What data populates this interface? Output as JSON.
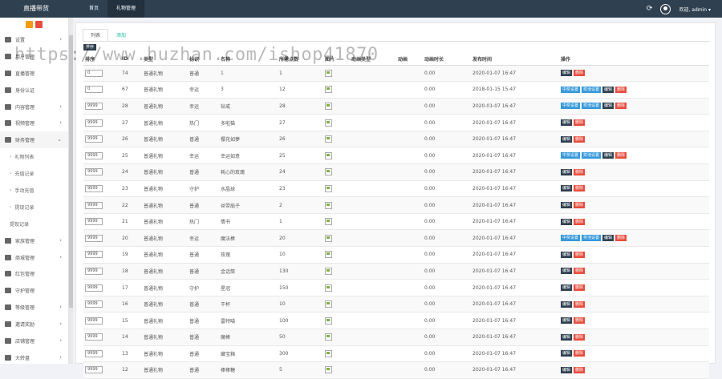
{
  "brand": "直播带货",
  "topnav": [
    {
      "label": "首页",
      "active": false
    },
    {
      "label": "礼物管理",
      "active": true
    }
  ],
  "user": {
    "welcome": "欢迎, admin ▾"
  },
  "sidebar": {
    "items": [
      {
        "label": "设置",
        "icon": "gear-icon",
        "arrow": "›"
      },
      {
        "label": "用户管理",
        "icon": "users-icon",
        "arrow": "›"
      },
      {
        "label": "直播管理",
        "icon": "trophy-icon",
        "arrow": ""
      },
      {
        "label": "身份认证",
        "icon": "id-card-icon",
        "arrow": ""
      },
      {
        "label": "内容管理",
        "icon": "monitor-icon",
        "arrow": "›"
      },
      {
        "label": "视频管理",
        "icon": "video-icon",
        "arrow": "›"
      },
      {
        "label": "财务管理",
        "icon": "yen-icon",
        "arrow": "⌄",
        "open": true
      },
      {
        "label": "礼物列表",
        "sub": true
      },
      {
        "label": "充值记录",
        "sub": true
      },
      {
        "label": "手动充值",
        "sub": true
      },
      {
        "label": "提现记录",
        "sub": true
      },
      {
        "label": "提现记录",
        "sub": true,
        "plain": true
      },
      {
        "label": "家族管理",
        "icon": "family-icon",
        "arrow": "›"
      },
      {
        "label": "商城管理",
        "icon": "cart-icon",
        "arrow": "›"
      },
      {
        "label": "红包管理",
        "icon": "envelope-icon",
        "arrow": ""
      },
      {
        "label": "守护管理",
        "icon": "shield-icon",
        "arrow": ""
      },
      {
        "label": "等级管理",
        "icon": "level-icon",
        "arrow": "›"
      },
      {
        "label": "邀请奖励",
        "icon": "sitemap-icon",
        "arrow": "›"
      },
      {
        "label": "店铺管理",
        "icon": "store-icon",
        "arrow": "›"
      },
      {
        "label": "大转盘",
        "icon": "wheel-icon",
        "arrow": "›"
      }
    ]
  },
  "tabs": {
    "list": "列表",
    "add": "添加"
  },
  "sort_button": "排序",
  "table": {
    "headers": [
      "排序",
      "ID",
      "类型",
      "标识",
      "名称",
      "所需点数",
      "图片",
      "动画类型",
      "动画",
      "动画时长",
      "发布时间",
      "操作"
    ],
    "rows": [
      {
        "sort": "0",
        "id": "74",
        "type": "普通礼物",
        "mark": "普通",
        "name": "1",
        "price": "1",
        "dur": "0.00",
        "time": "2020-01-07 16:47",
        "ops": [
          "编辑",
          "删除"
        ]
      },
      {
        "sort": "0",
        "id": "67",
        "type": "普通礼物",
        "mark": "幸运",
        "name": "3",
        "price": "12",
        "dur": "0.00",
        "time": "2018-01-15 15:47",
        "ops": [
          "中奖设置",
          "奖池设置",
          "编辑",
          "删除"
        ]
      },
      {
        "sort": "9999",
        "id": "28",
        "type": "普通礼物",
        "mark": "幸运",
        "name": "钻戒",
        "price": "28",
        "dur": "0.00",
        "time": "2020-01-07 16:47",
        "ops": [
          "中奖设置",
          "奖池设置",
          "编辑",
          "删除"
        ]
      },
      {
        "sort": "9999",
        "id": "27",
        "type": "普通礼物",
        "mark": "热门",
        "name": "多啦猫",
        "price": "27",
        "dur": "0.00",
        "time": "2020-01-07 16:47",
        "ops": [
          "编辑",
          "删除"
        ]
      },
      {
        "sort": "9999",
        "id": "26",
        "type": "普通礼物",
        "mark": "普通",
        "name": "樱花如夢",
        "price": "26",
        "dur": "0.00",
        "time": "2020-01-07 16:47",
        "ops": [
          "编辑",
          "删除"
        ]
      },
      {
        "sort": "9999",
        "id": "25",
        "type": "普通礼物",
        "mark": "幸运",
        "name": "幸运如意",
        "price": "25",
        "dur": "0.00",
        "time": "2020-01-07 16:47",
        "ops": [
          "中奖设置",
          "奖池设置",
          "编辑",
          "删除"
        ]
      },
      {
        "sort": "9999",
        "id": "24",
        "type": "普通礼物",
        "mark": "普通",
        "name": "耗心的玫瑰",
        "price": "24",
        "dur": "0.00",
        "time": "2020-01-07 16:47",
        "ops": [
          "编辑",
          "删除"
        ]
      },
      {
        "sort": "9999",
        "id": "23",
        "type": "普通礼物",
        "mark": "守护",
        "name": "水晶球",
        "price": "23",
        "dur": "0.00",
        "time": "2020-01-07 16:47",
        "ops": [
          "编辑",
          "删除"
        ]
      },
      {
        "sort": "9999",
        "id": "22",
        "type": "普通礼物",
        "mark": "普通",
        "name": "丝带扇子",
        "price": "2",
        "dur": "0.00",
        "time": "2020-01-07 16:47",
        "ops": [
          "编辑",
          "删除"
        ]
      },
      {
        "sort": "9999",
        "id": "21",
        "type": "普通礼物",
        "mark": "热门",
        "name": "情书",
        "price": "1",
        "dur": "0.00",
        "time": "2020-01-07 16:47",
        "ops": [
          "编辑",
          "删除"
        ]
      },
      {
        "sort": "9999",
        "id": "20",
        "type": "普通礼物",
        "mark": "幸运",
        "name": "魔法棒",
        "price": "20",
        "dur": "0.00",
        "time": "2020-01-07 16:47",
        "ops": [
          "中奖设置",
          "奖池设置",
          "编辑",
          "删除"
        ]
      },
      {
        "sort": "9999",
        "id": "19",
        "type": "普通礼物",
        "mark": "普通",
        "name": "玫瑰",
        "price": "10",
        "dur": "0.00",
        "time": "2020-01-07 16:47",
        "ops": [
          "编辑",
          "删除"
        ]
      },
      {
        "sort": "9999",
        "id": "18",
        "type": "普通礼物",
        "mark": "普通",
        "name": "金话筒",
        "price": "130",
        "dur": "0.00",
        "time": "2020-01-07 16:47",
        "ops": [
          "编辑",
          "删除"
        ]
      },
      {
        "sort": "9999",
        "id": "17",
        "type": "普通礼物",
        "mark": "守护",
        "name": "星冠",
        "price": "150",
        "dur": "0.00",
        "time": "2020-01-07 16:47",
        "ops": [
          "编辑",
          "删除"
        ]
      },
      {
        "sort": "9999",
        "id": "16",
        "type": "普通礼物",
        "mark": "普通",
        "name": "干杯",
        "price": "10",
        "dur": "0.00",
        "time": "2020-01-07 16:47",
        "ops": [
          "编辑",
          "删除"
        ]
      },
      {
        "sort": "9999",
        "id": "15",
        "type": "普通礼物",
        "mark": "普通",
        "name": "雷特喵",
        "price": "100",
        "dur": "0.00",
        "time": "2020-01-07 16:47",
        "ops": [
          "编辑",
          "删除"
        ]
      },
      {
        "sort": "9999",
        "id": "14",
        "type": "普通礼物",
        "mark": "普通",
        "name": "魔棒",
        "price": "50",
        "dur": "0.00",
        "time": "2020-01-07 16:47",
        "ops": [
          "编辑",
          "删除"
        ]
      },
      {
        "sort": "9999",
        "id": "13",
        "type": "普通礼物",
        "mark": "普通",
        "name": "藏宝箱",
        "price": "300",
        "dur": "0.00",
        "time": "2020-01-07 16:47",
        "ops": [
          "编辑",
          "删除"
        ]
      },
      {
        "sort": "9999",
        "id": "12",
        "type": "普通礼物",
        "mark": "普通",
        "name": "棒棒糖",
        "price": "5",
        "dur": "0.00",
        "time": "2020-01-07 16:47",
        "ops": [
          "编辑",
          "删除"
        ]
      }
    ]
  },
  "colors": {
    "topbar": "#2f4050",
    "accent": "#1abc9c",
    "blue_btn": "#3498db",
    "red_btn": "#e74c3c"
  },
  "watermark": "https://www.huzhan.com/ishop41870"
}
